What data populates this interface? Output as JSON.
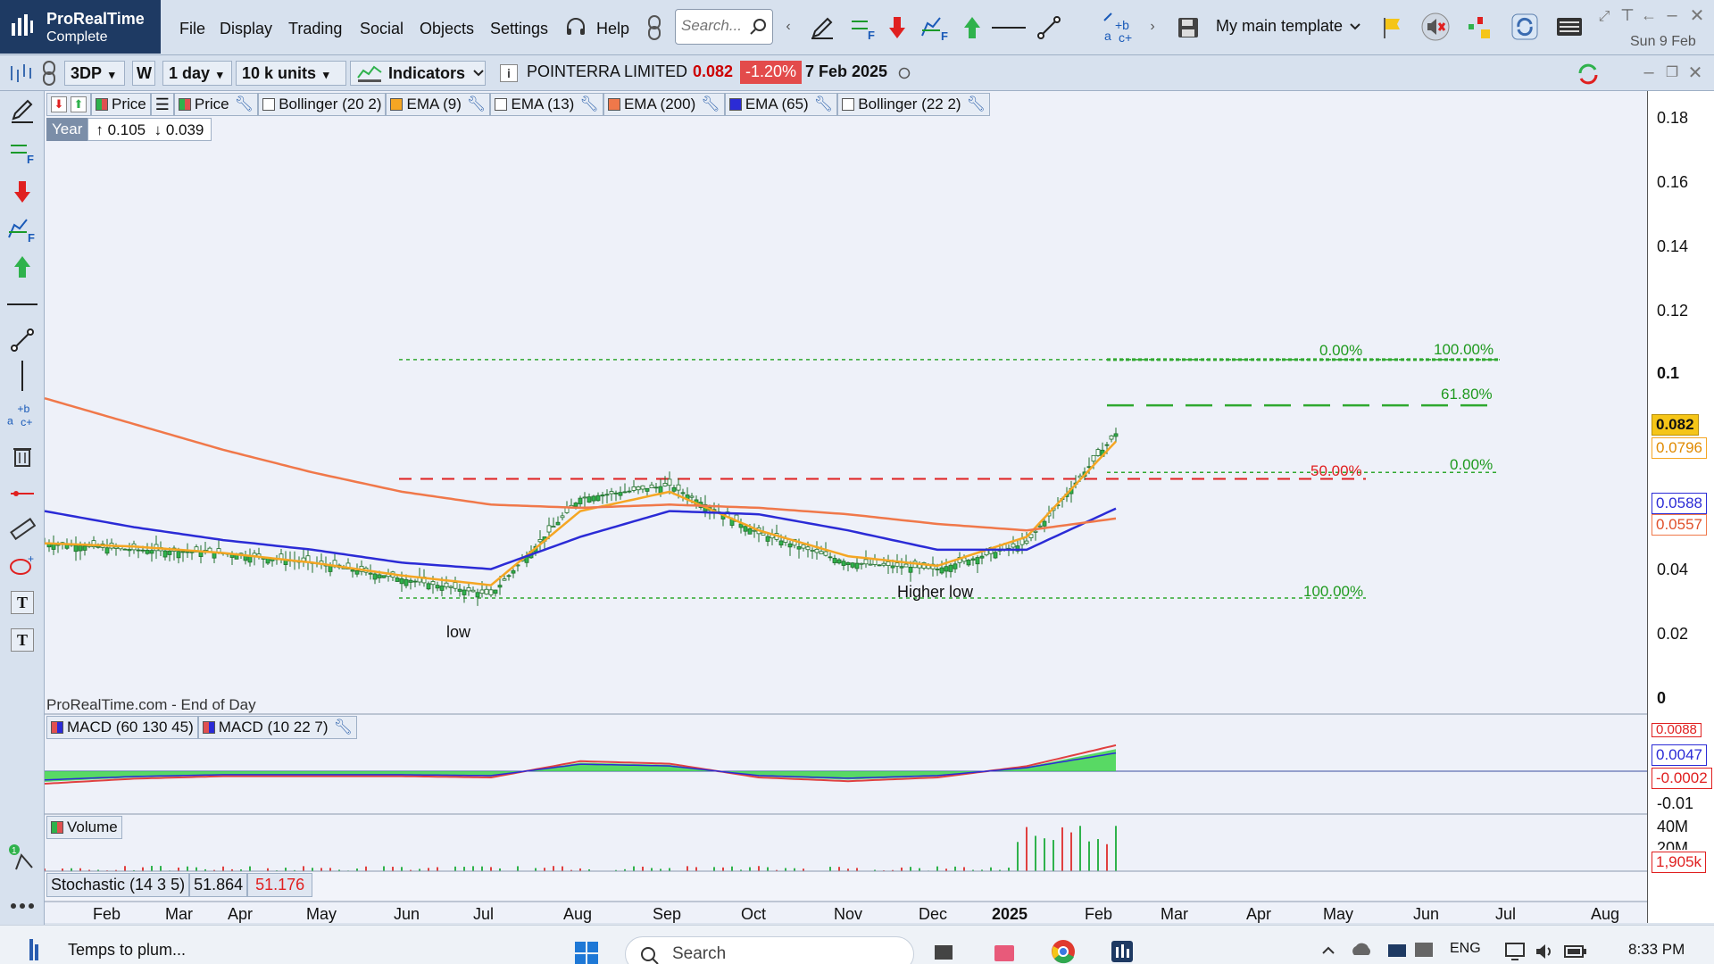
{
  "app": {
    "name": "ProRealTime",
    "edition": "Complete",
    "menu": [
      "File",
      "Display",
      "Trading",
      "Social",
      "Objects",
      "Settings"
    ],
    "help_label": "Help",
    "search_placeholder": "Search...",
    "template_label": "My main template",
    "top_date": "Sun 9 Feb"
  },
  "toolbar": {
    "ticker": "3DP",
    "w_button": "W",
    "interval": "1 day",
    "units": "10 k units",
    "indicators_label": "Indicators",
    "instrument_name": "POINTERRA LIMITED",
    "last_price": "0.082",
    "change": "-1.20%",
    "date": "7 Feb 2025"
  },
  "legend": {
    "items": [
      {
        "label": "Price",
        "color": "#2fb24c"
      },
      {
        "label": "Price",
        "color": "#2fb24c"
      },
      {
        "label": "Bollinger (20 2)",
        "color": "#ffffff"
      },
      {
        "label": "EMA (9)",
        "color": "#f5a623"
      },
      {
        "label": "EMA (13)",
        "color": "#ffffff"
      },
      {
        "label": "EMA (200)",
        "color": "#f0784a"
      },
      {
        "label": "EMA (65)",
        "color": "#2b2bd6"
      },
      {
        "label": "Bollinger (22 2)",
        "color": "#ffffff"
      }
    ],
    "year_label": "Year",
    "year_high": "0.105",
    "year_low": "0.039"
  },
  "annotations": {
    "low": "low",
    "higher_low": "Higher low",
    "source": "ProRealTime.com - End of Day",
    "fib_top_0": "0.00%",
    "fib_top_100": "100.00%",
    "fib_618": "61.80%",
    "fib_50": "50.00%",
    "fib_mid_0": "0.00%",
    "fib_bottom_100": "100.00%"
  },
  "price_axis": {
    "ticks": [
      "0.18",
      "0.16",
      "0.14",
      "0.12",
      "0.1",
      "0.04",
      "0.02",
      "0"
    ],
    "tag_last": "0.082",
    "tag_ema9": "0.0796",
    "tag_ema65": "0.0588",
    "tag_ema200": "0.0557",
    "macd_ticks": [
      "0.0088",
      "0.0047",
      "-0.0002",
      "-0.01"
    ],
    "vol_ticks": [
      "40M",
      "20M",
      "1,905k"
    ]
  },
  "macd": {
    "legend1": "MACD (60 130 45)",
    "legend2": "MACD (10 22 7)"
  },
  "volume": {
    "legend": "Volume"
  },
  "stochastic": {
    "label": "Stochastic (14 3 5)",
    "v1": "51.864",
    "v2": "51.176"
  },
  "time_axis": [
    "Feb",
    "Mar",
    "Apr",
    "May",
    "Jun",
    "Jul",
    "Aug",
    "Sep",
    "Oct",
    "Nov",
    "Dec",
    "2025",
    "Feb",
    "Mar",
    "Apr",
    "May",
    "Jun",
    "Jul",
    "Aug"
  ],
  "taskbar": {
    "window_title": "Temps to plum...",
    "search": "Search",
    "lang": "ENG",
    "time": "8:33 PM"
  },
  "chart_data": {
    "type": "line",
    "title": "POINTERRA LIMITED (3DP) daily",
    "y_range": [
      0,
      0.18
    ],
    "x": [
      "Feb",
      "Mar",
      "Apr",
      "May",
      "Jun",
      "Jul",
      "Aug",
      "Sep",
      "Oct",
      "Nov",
      "Dec",
      "2025",
      "Feb"
    ],
    "series": [
      {
        "name": "Price",
        "values": [
          0.048,
          0.046,
          0.045,
          0.042,
          0.037,
          0.032,
          0.062,
          0.066,
          0.051,
          0.042,
          0.04,
          0.048,
          0.082
        ]
      },
      {
        "name": "EMA (9)",
        "values": [
          0.048,
          0.047,
          0.045,
          0.042,
          0.038,
          0.035,
          0.058,
          0.064,
          0.052,
          0.044,
          0.041,
          0.05,
          0.0796
        ]
      },
      {
        "name": "EMA (65)",
        "values": [
          0.058,
          0.053,
          0.049,
          0.046,
          0.042,
          0.04,
          0.05,
          0.058,
          0.057,
          0.052,
          0.046,
          0.046,
          0.0588
        ]
      },
      {
        "name": "EMA (200)",
        "values": [
          0.093,
          0.085,
          0.077,
          0.07,
          0.064,
          0.06,
          0.059,
          0.06,
          0.059,
          0.057,
          0.054,
          0.052,
          0.0557
        ]
      }
    ]
  }
}
